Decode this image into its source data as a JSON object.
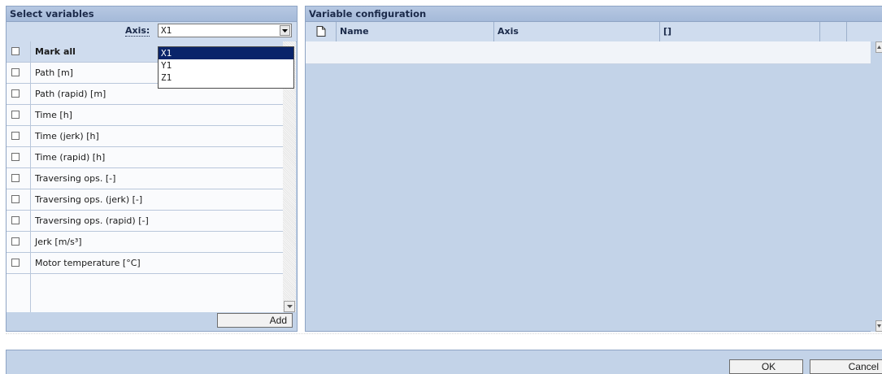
{
  "select_panel": {
    "title": "Select variables",
    "axis_label": "Axis:",
    "axis_value": "X1",
    "axis_options": [
      "X1",
      "Y1",
      "Z1"
    ],
    "mark_all_label": "Mark all",
    "variables": [
      "Path [m]",
      "Path (rapid) [m]",
      "Time [h]",
      "Time (jerk) [h]",
      "Time (rapid) [h]",
      "Traversing ops. [-]",
      "Traversing ops. (jerk) [-]",
      "Traversing ops. (rapid) [-]",
      "Jerk [m/s³]",
      "Motor temperature [°C]"
    ],
    "add_label": "Add"
  },
  "config_panel": {
    "title": "Variable configuration",
    "columns": [
      "Name",
      "Axis",
      "[]"
    ]
  },
  "footer": {
    "ok_label": "OK",
    "cancel_label": "Cancel"
  },
  "colors": {
    "panel_bg": "#c3d3e8",
    "selected_option": "#0a246a"
  },
  "icons": {
    "axis_dropdown": "chevron-down-icon",
    "config_header": "document-icon"
  }
}
